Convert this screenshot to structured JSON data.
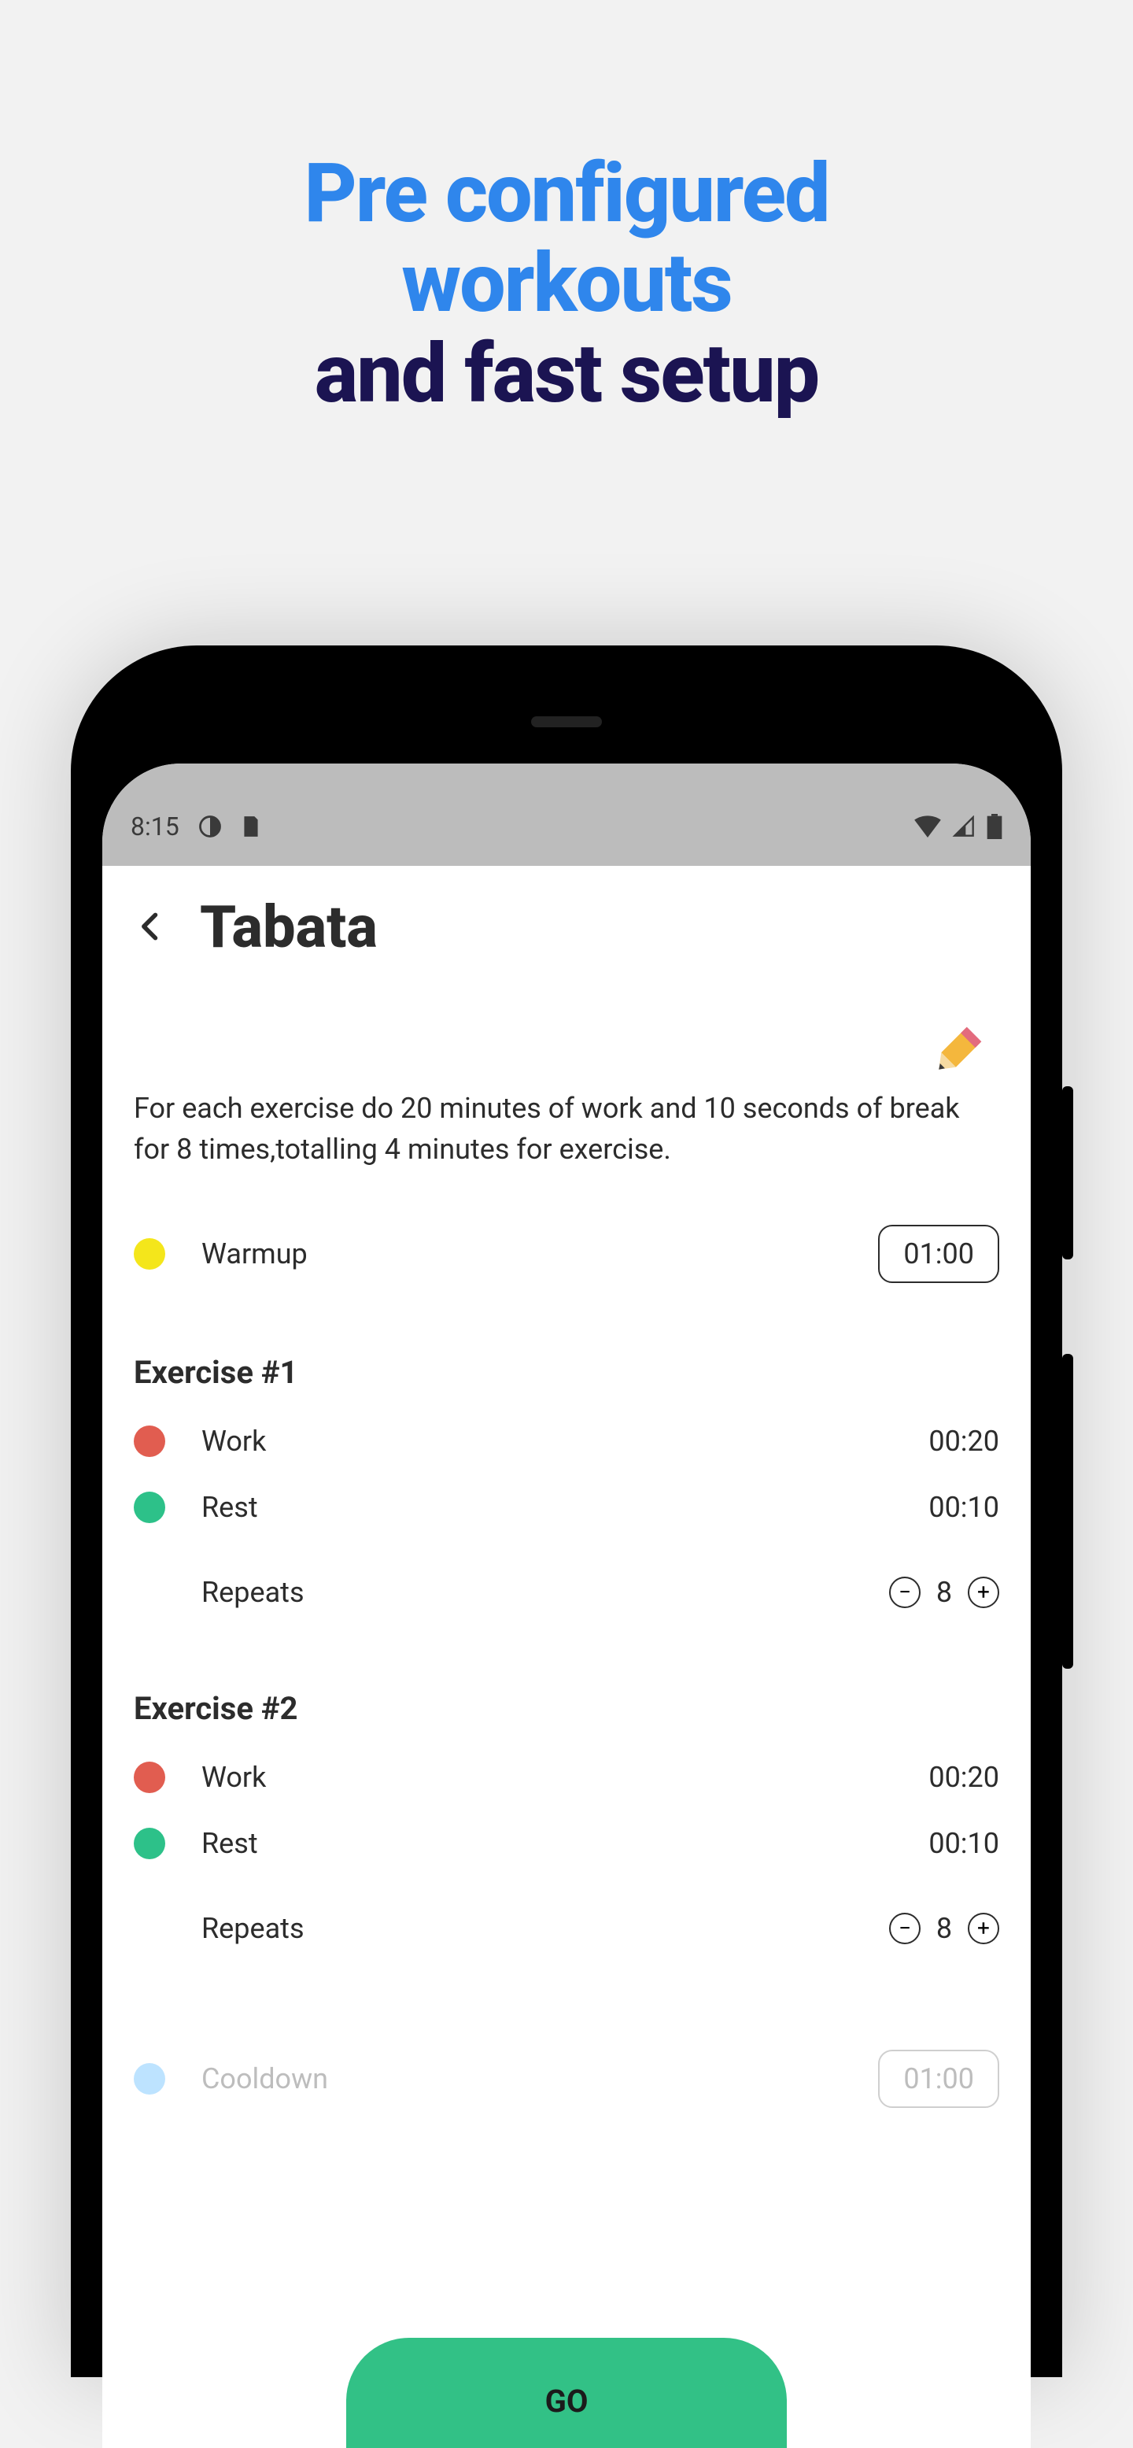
{
  "hero": {
    "line1a": "Pre configured",
    "line1b": "workouts",
    "line2": "and fast setup"
  },
  "statusbar": {
    "time": "8:15"
  },
  "app": {
    "title": "Tabata",
    "description": "For each exercise do 20 minutes of work and 10 seconds of break for 8 times,totalling 4 minutes for exercise.",
    "warmup": {
      "label": "Warmup",
      "time": "01:00"
    },
    "exercises": [
      {
        "title": "Exercise #1",
        "work": {
          "label": "Work",
          "time": "00:20"
        },
        "rest": {
          "label": "Rest",
          "time": "00:10"
        },
        "repeats": {
          "label": "Repeats",
          "count": "8"
        }
      },
      {
        "title": "Exercise #2",
        "work": {
          "label": "Work",
          "time": "00:20"
        },
        "rest": {
          "label": "Rest",
          "time": "00:10"
        },
        "repeats": {
          "label": "Repeats",
          "count": "8"
        }
      }
    ],
    "cooldown": {
      "label": "Cooldown",
      "time": "01:00"
    },
    "go": "GO"
  }
}
